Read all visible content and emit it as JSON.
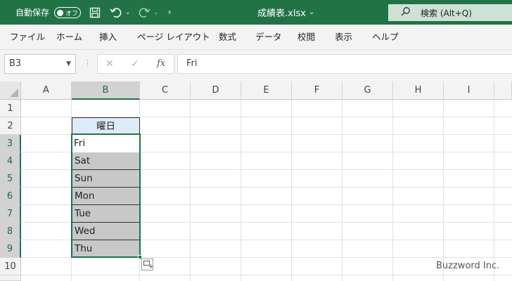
{
  "titlebar": {
    "autosave_label": "自動保存",
    "autosave_state": "オフ",
    "filename": "成績表.xlsx",
    "filename_chevron": "⌄",
    "search_placeholder": "検索 (Alt+Q)",
    "accent_color": "#217346",
    "icons": [
      "save-icon",
      "undo-icon",
      "redo-icon",
      "customize-toolbar-icon",
      "search-icon"
    ]
  },
  "ribbon": {
    "tabs": [
      "ファイル",
      "ホーム",
      "挿入",
      "ページ レイアウト",
      "数式",
      "データ",
      "校閲",
      "表示",
      "ヘルプ"
    ]
  },
  "formula_bar": {
    "name_box": "B3",
    "fx_label": "fx",
    "content": "Fri"
  },
  "sheet": {
    "columns": [
      "A",
      "B",
      "C",
      "D",
      "E",
      "F",
      "G",
      "H",
      "I"
    ],
    "selected_column": "B",
    "rows": [
      "1",
      "2",
      "3",
      "4",
      "5",
      "6",
      "7",
      "8",
      "9",
      "10"
    ],
    "selected_rows": [
      "3",
      "4",
      "5",
      "6",
      "7",
      "8",
      "9"
    ],
    "b2_header": "曜日",
    "b_values": [
      "Fri",
      "Sat",
      "Sun",
      "Mon",
      "Tue",
      "Wed",
      "Thu"
    ],
    "active_cell": "B3",
    "selection_range": "B3:B9"
  },
  "watermark": "Buzzword Inc."
}
